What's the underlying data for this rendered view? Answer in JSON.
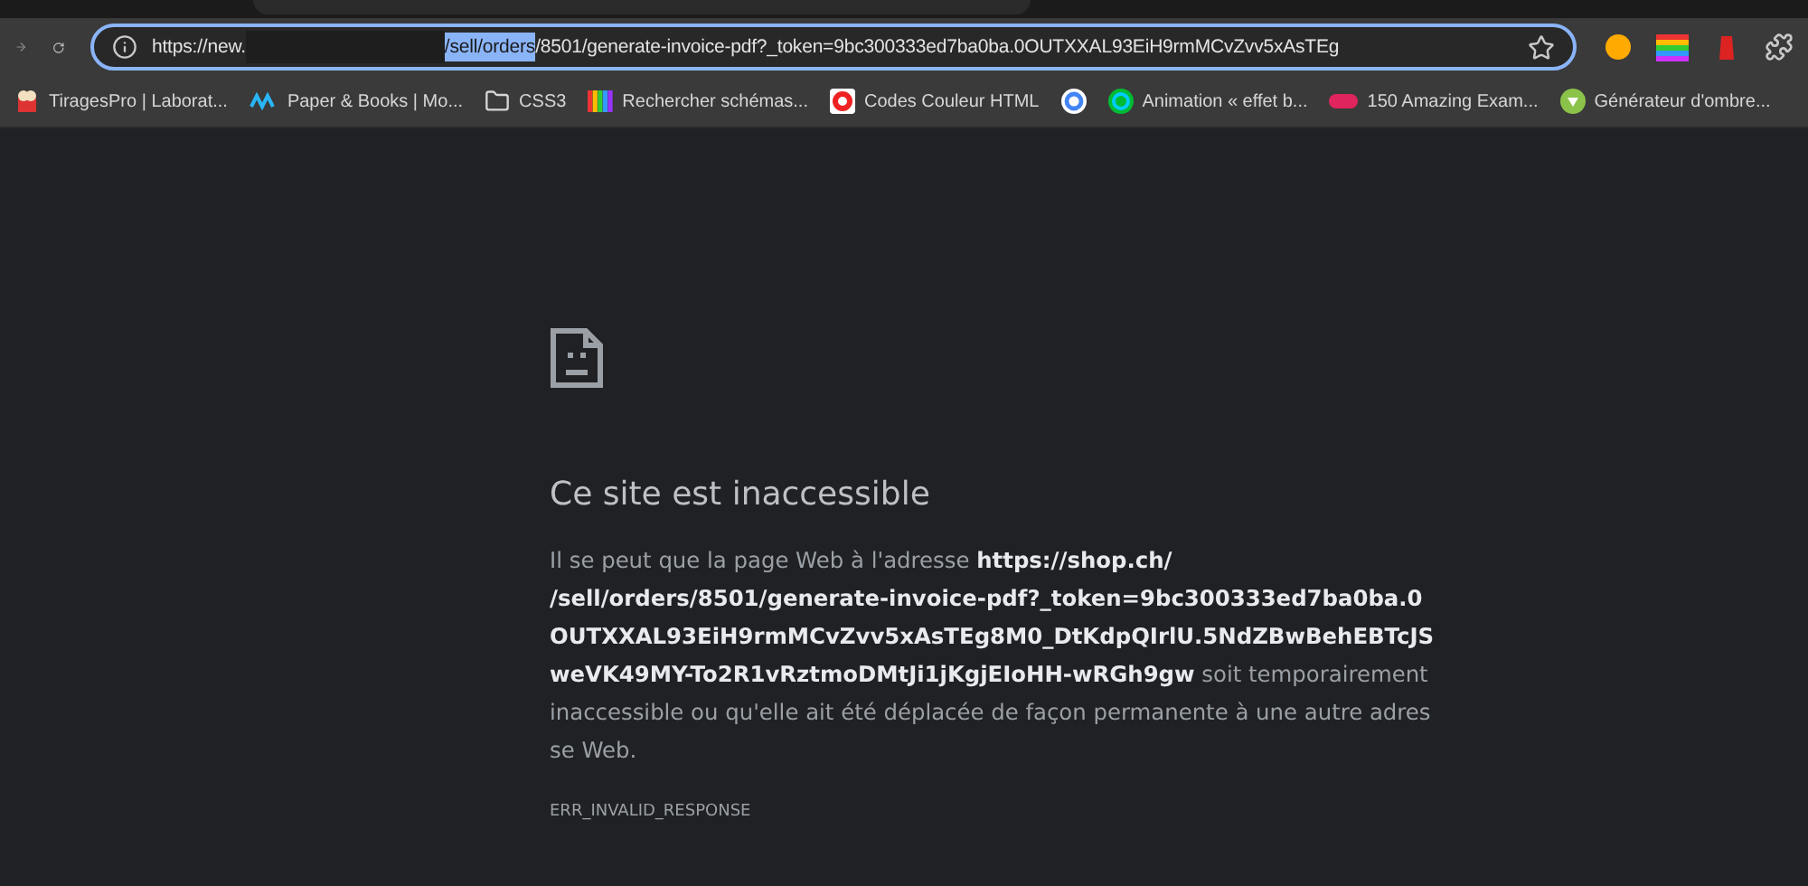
{
  "toolbar": {
    "address_bar": {
      "prefix": "https://new.",
      "selected_text": "/sell/orders",
      "suffix": "/8501/generate-invoice-pdf?_token=9bc300333ed7ba0ba.0OUTXXAL93EiH9rmMCvZvv5xAsTEg"
    }
  },
  "bookmarks": [
    {
      "label": "TiragesPro | Laborat...",
      "kind": "popcorn"
    },
    {
      "label": "Paper & Books | Mo...",
      "kind": "wave"
    },
    {
      "label": "CSS3",
      "kind": "folder"
    },
    {
      "label": "Rechercher schémas...",
      "kind": "stripes"
    },
    {
      "label": "Codes Couleur HTML",
      "kind": "ring"
    },
    {
      "kind": "google"
    },
    {
      "label": "Animation « effet b...",
      "kind": "c"
    },
    {
      "label": "150 Amazing Exam...",
      "kind": "pill"
    },
    {
      "label": "Générateur d'ombre...",
      "kind": "shield"
    }
  ],
  "error_page": {
    "title": "Ce site est inaccessible",
    "message": "Il se peut que la page Web à l'adresse **https://shop.ch/                                  /sell/orders/8501/generate-invoice-pdf?_token=9bc300333ed7ba0ba.0OUTXXAL93EiH9rmMCvZvv5xAsTEg8M0_DtKdpQIrlU.5NdZBwBehEBTcJSweVK49MY-To2R1vRztmoDMtJi1jKgjEIoHH-wRGh9gw** soit temporairement inaccessible ou qu'elle ait été déplacée de façon permanente à une autre adresse Web.",
    "error_code": "ERR_INVALID_RESPONSE"
  }
}
